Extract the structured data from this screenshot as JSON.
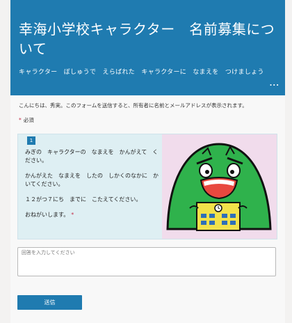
{
  "header": {
    "title": "幸海小学校キャラクター　名前募集について",
    "subtitle": "キャラクター　ぼしゅうで　えらばれた　キャラクターに　なまえを　つけましょう",
    "more_label": "..."
  },
  "form": {
    "intro": "こんにちは、秀実。このフォームを送信すると、所有者に名前とメールアドレスが表示されます。",
    "required_note": "必須",
    "required_star": "*"
  },
  "question": {
    "number": "1",
    "paragraphs": [
      "みぎの　キャラクターの　なまえを　かんがえて　ください。",
      "かんがえた　なまえを　したの　しかくのなかに　かいてください。",
      "１２がつ７にち　までに　こたえてください。",
      "おねがいします。"
    ],
    "required_star": "*",
    "image_icon": "mascot-character-image"
  },
  "answer": {
    "placeholder": "回答を入力してください",
    "value": ""
  },
  "submit": {
    "label": "送信"
  },
  "colors": {
    "accent": "#1f7bb0",
    "required": "#c4314b",
    "question_bg": "#deeff3",
    "character_green": "#2fb24c"
  }
}
